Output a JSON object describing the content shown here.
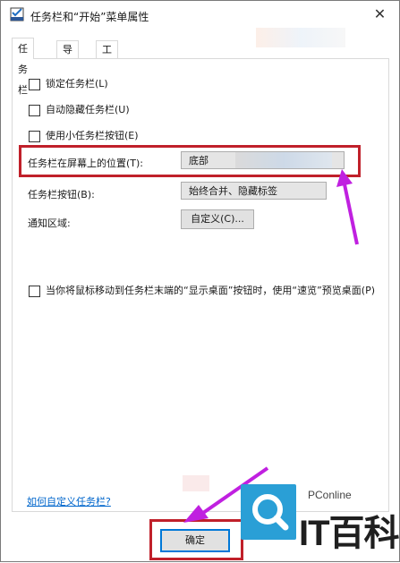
{
  "window": {
    "title": "任务栏和“开始”菜单属性",
    "close_glyph": "✕"
  },
  "tabs": [
    {
      "label": "任务栏",
      "active": true
    },
    {
      "label": "导航",
      "active": false
    },
    {
      "label": "工具栏",
      "active": false
    }
  ],
  "options": {
    "lock": {
      "label": "锁定任务栏(L)",
      "checked": false
    },
    "autohide": {
      "label": "自动隐藏任务栏(U)",
      "checked": false
    },
    "small_buttons": {
      "label": "使用小任务栏按钮(E)",
      "checked": false
    }
  },
  "location": {
    "label": "任务栏在屏幕上的位置(T):",
    "value": "底部"
  },
  "buttons_combine": {
    "label": "任务栏按钮(B):",
    "value": "始终合并、隐藏标签"
  },
  "notification": {
    "label": "通知区域:",
    "button": "自定义(C)..."
  },
  "peek": {
    "label": "当你将鼠标移动到任务栏末端的“显示桌面”按钮时，使用“速览”预览桌面(P)",
    "checked": false
  },
  "help_link": "如何自定义任务栏?",
  "footer": {
    "ok": "确定"
  },
  "watermark": {
    "site": "PConline",
    "name": "IT百科"
  },
  "colors": {
    "highlight": "#c0202a",
    "arrow": "#c020e0",
    "brand": "#2a9fd6",
    "link": "#0066cc"
  }
}
